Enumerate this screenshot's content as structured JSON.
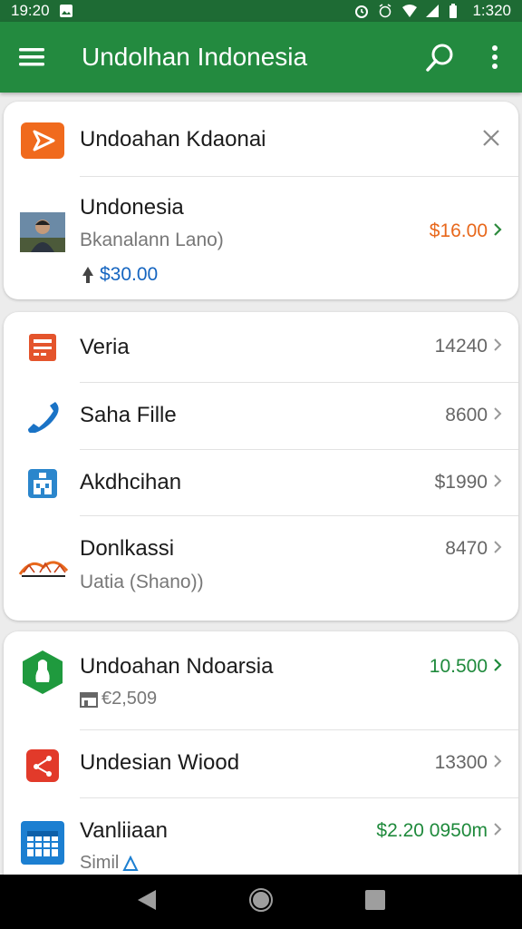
{
  "statusbar": {
    "time": "19:20",
    "clock": "1:320"
  },
  "appbar": {
    "title": "Undolhan Indonesia"
  },
  "card1": {
    "header_title": "Undoahan Kdaonai",
    "item_title": "Undonesia",
    "item_subtitle": "Bkanalann Lano)",
    "item_price": "$16.00",
    "item_amount": "$30.00"
  },
  "card2": {
    "items": [
      {
        "label": "Veria",
        "value": "14240"
      },
      {
        "label": "Saha Fille",
        "value": "8600"
      },
      {
        "label": "Akdhcihan",
        "value": "$1990"
      },
      {
        "label": "Donlkassi",
        "sublabel": "Uatia (Shano))",
        "value": "8470"
      }
    ]
  },
  "card3": {
    "items": [
      {
        "label": "Undoahan Ndoarsia",
        "sublabel": "€2,509",
        "value": "10.500"
      },
      {
        "label": "Undesian Wiood",
        "value": "13300"
      },
      {
        "label": "Vanliiaan",
        "sublabel": "Simil",
        "value": "$2.20 0950m"
      }
    ]
  },
  "colors": {
    "appbar": "#238a3f",
    "statusbar": "#1e6b34",
    "orange": "#e8681c",
    "green": "#1f8a3c",
    "blue": "#1565c0",
    "red": "#e03b2c"
  }
}
